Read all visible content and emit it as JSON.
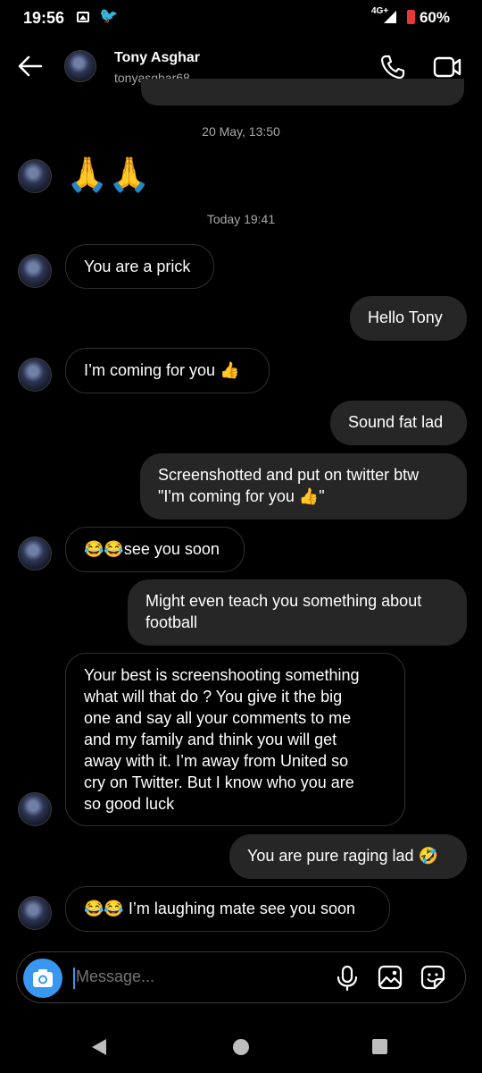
{
  "status": {
    "time": "19:56",
    "network": "4G+",
    "battery": "60%",
    "icons": [
      "image-notification-icon",
      "twitter-bird-icon",
      "signal-icon",
      "battery-icon"
    ]
  },
  "header": {
    "name": "Tony Asghar",
    "username": "tonyasghar68",
    "icons": [
      "back-arrow-icon",
      "phone-icon",
      "video-camera-icon"
    ]
  },
  "timestamps": {
    "first": "20 May, 13:50",
    "second": "Today 19:41"
  },
  "messages": [
    {
      "from": "them",
      "text": "🙏🙏"
    },
    {
      "from": "them",
      "text": "You are a prick"
    },
    {
      "from": "me",
      "text": "Hello Tony"
    },
    {
      "from": "them",
      "text": "I’m coming for you 👍"
    },
    {
      "from": "me",
      "text": "Sound fat lad"
    },
    {
      "from": "me",
      "text": "Screenshotted and put on twitter btw\n\"I'm coming for you 👍\""
    },
    {
      "from": "them",
      "text": "😂😂see you soon"
    },
    {
      "from": "me",
      "text": "Might even teach you something about\nfootball"
    },
    {
      "from": "them",
      "text": "Your best is screenshooting something\nwhat will that do ? You give it the big\none and say all your comments to me\nand my family and think you will get\naway with it. I’m away from United so\ncry on Twitter. But I know who you are\nso good luck"
    },
    {
      "from": "me",
      "text": "You are pure raging lad 🤣"
    },
    {
      "from": "them",
      "text": "😂😂 I’m laughing mate see you soon"
    }
  ],
  "composer": {
    "placeholder": "Message...",
    "icons": [
      "camera-icon",
      "microphone-icon",
      "gallery-icon",
      "sticker-icon"
    ]
  },
  "colors": {
    "background": "#000000",
    "outgoing_bubble": "#262626",
    "incoming_border": "#2f2f2f",
    "accent": "#3897f0",
    "muted_text": "#a8a8a8"
  }
}
